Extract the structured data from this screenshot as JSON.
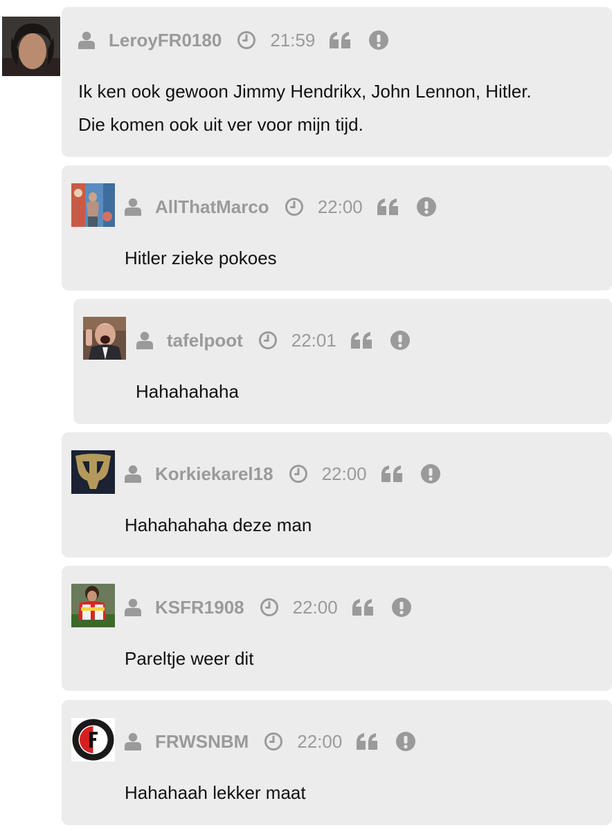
{
  "colors": {
    "card_background": "#ececec",
    "meta_text": "#9a9a9a",
    "body_text": "#111111"
  },
  "icons": {
    "user": "user-icon",
    "time": "clock-icon",
    "quote": "quote-icon",
    "report": "exclamation-icon"
  },
  "comments": [
    {
      "username": "LeroyFR0180",
      "time": "21:59",
      "body": [
        "Ik ken ook gewoon Jimmy Hendrikx, John Lennon, Hitler.",
        "Die komen ook uit ver voor mijn tijd."
      ]
    },
    {
      "username": "AllThatMarco",
      "time": "22:00",
      "body": [
        "Hitler zieke pokoes"
      ]
    },
    {
      "username": "tafelpoot",
      "time": "22:01",
      "body": [
        "Hahahahaha"
      ]
    },
    {
      "username": "Korkiekarel18",
      "time": "22:00",
      "body": [
        "Hahahahaha deze man"
      ]
    },
    {
      "username": "KSFR1908",
      "time": "22:00",
      "body": [
        "Pareltje weer dit"
      ]
    },
    {
      "username": "FRWSNBM",
      "time": "22:00",
      "body": [
        "Hahahaah lekker maat"
      ]
    }
  ]
}
